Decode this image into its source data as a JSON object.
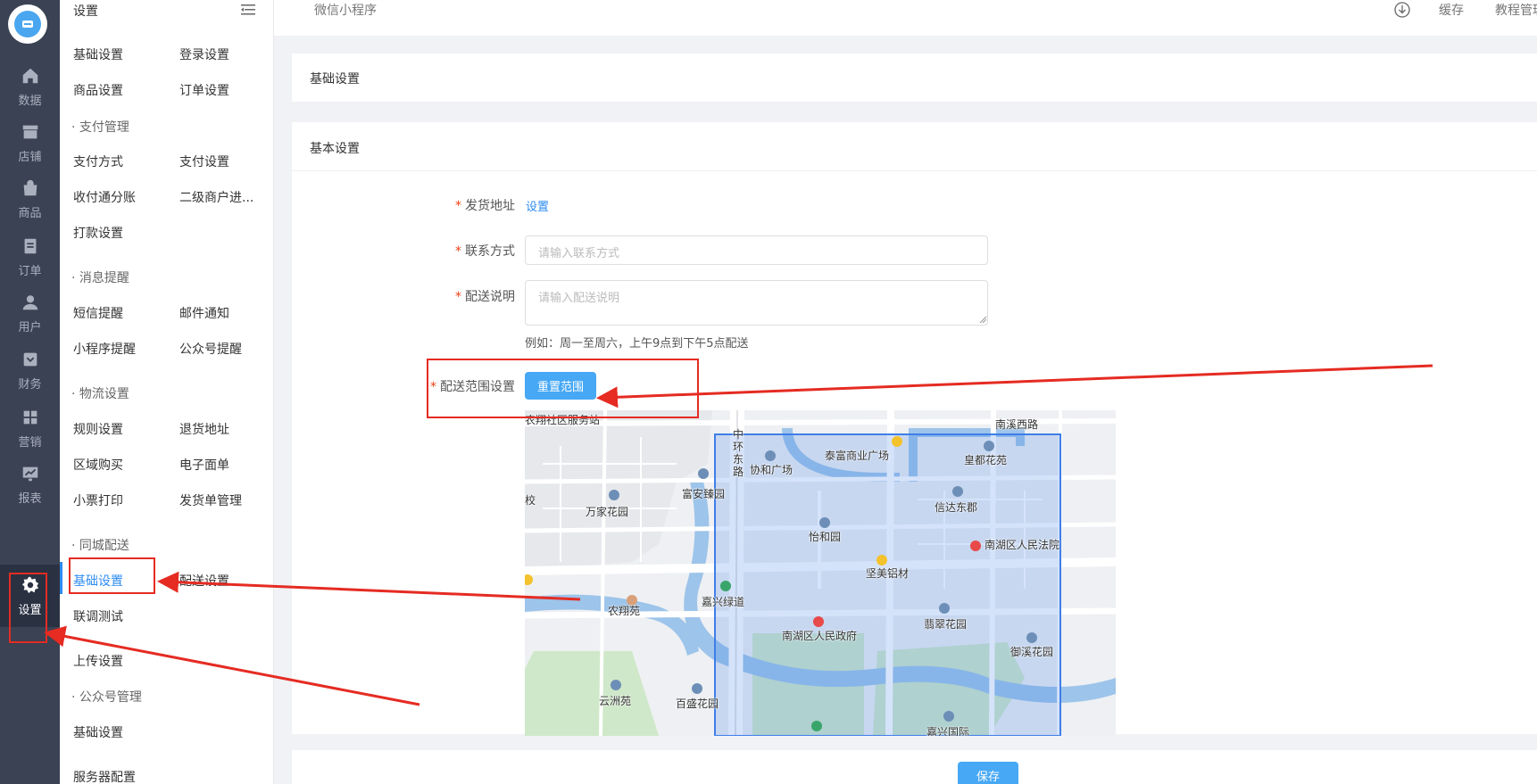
{
  "rail": {
    "items": [
      {
        "label": "数据",
        "icon": "home-icon"
      },
      {
        "label": "店铺",
        "icon": "store-icon"
      },
      {
        "label": "商品",
        "icon": "bag-icon"
      },
      {
        "label": "订单",
        "icon": "order-icon"
      },
      {
        "label": "用户",
        "icon": "user-icon"
      },
      {
        "label": "财务",
        "icon": "finance-icon"
      },
      {
        "label": "营销",
        "icon": "grid-icon"
      },
      {
        "label": "报表",
        "icon": "chart-icon"
      },
      {
        "label": "设置",
        "icon": "gear-icon"
      }
    ]
  },
  "menu": {
    "title": "设置",
    "base_settings": "基础设置",
    "login_settings": "登录设置",
    "goods_settings": "商品设置",
    "order_settings": "订单设置",
    "pay_group": "· 支付管理",
    "pay_method": "支付方式",
    "pay_settings": "支付设置",
    "split_account": "收付通分账",
    "sub_merchant": "二级商户进...",
    "payout_settings": "打款设置",
    "msg_group": "· 消息提醒",
    "sms_notice": "短信提醒",
    "mail_notice": "邮件通知",
    "miniapp_notice": "小程序提醒",
    "official_notice": "公众号提醒",
    "logistics_group": "· 物流设置",
    "rule_settings": "规则设置",
    "return_address": "退货地址",
    "area_purchase": "区域购买",
    "e_waybill": "电子面单",
    "receipt_print": "小票打印",
    "shipping_manage": "发货单管理",
    "city_group": "· 同城配送",
    "city_base": "基础设置",
    "city_delivery": "配送设置",
    "joint_test": "联调测试",
    "upload_settings": "上传设置",
    "official_group": "· 公众号管理",
    "official_base": "基础设置",
    "server_config": "服务器配置"
  },
  "topbar": {
    "crumb": "微信小程序",
    "cache": "缓存",
    "tutorial": "教程管理"
  },
  "main": {
    "card1_title": "基础设置",
    "card2_title": "基本设置",
    "ship_address_label": "发货地址",
    "ship_address_link": "设置",
    "contact_label": "联系方式",
    "contact_placeholder": "请输入联系方式",
    "desc_label": "配送说明",
    "desc_placeholder": "请输入配送说明",
    "desc_hint": "例如：周一至周六，上午9点到下午5点配送",
    "range_label": "配送范围设置",
    "reset_range_button": "重置范围",
    "save_button": "保存"
  },
  "map": {
    "labels": {
      "l1": "农翔社区服务站",
      "l2": "南溪西路",
      "l3": "泰富商业广场",
      "l4": "皇都花苑",
      "l5": "协和广场",
      "l6": "富安臻园",
      "l7": "信达东郡",
      "l8": "万家花园",
      "l9": "怡和园",
      "l10": "南湖区人民法院",
      "l11": "坚美铝材",
      "l12": "嘉兴绿道",
      "l13": "农翔苑",
      "l14": "南湖区人民政府",
      "l15": "翡翠花园",
      "l16": "御溪花园",
      "l17": "云洲苑",
      "l18": "百盛花园",
      "l19": "嘉兴国际",
      "l20": "中环东路",
      "l21": "校"
    }
  },
  "colors": {
    "accent": "#2d8cf0",
    "rail_bg": "#3a4254",
    "annotation": "#e52b22"
  }
}
